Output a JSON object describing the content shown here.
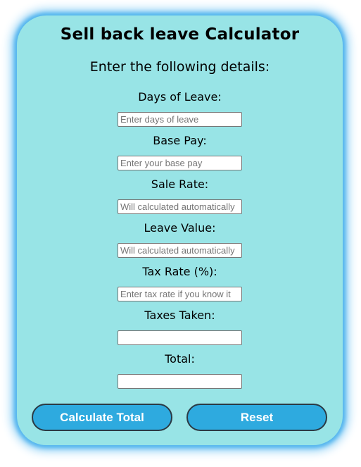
{
  "title": "Sell back leave Calculator",
  "subtitle": "Enter the following details:",
  "fields": [
    {
      "label": "Days of Leave:",
      "placeholder": "Enter days of leave",
      "value": ""
    },
    {
      "label": "Base Pay:",
      "placeholder": "Enter your base pay",
      "value": ""
    },
    {
      "label": "Sale Rate:",
      "placeholder": "Will calculated automatically",
      "value": ""
    },
    {
      "label": "Leave Value:",
      "placeholder": "Will calculated automatically",
      "value": ""
    },
    {
      "label": "Tax Rate (%):",
      "placeholder": "Enter tax rate if you know it",
      "value": ""
    },
    {
      "label": "Taxes Taken:",
      "placeholder": "",
      "value": ""
    },
    {
      "label": "Total:",
      "placeholder": "",
      "value": ""
    }
  ],
  "buttons": {
    "calculate": "Calculate Total",
    "reset": "Reset"
  },
  "colors": {
    "card_background": "#98e4e6",
    "glow": "#52b4ee",
    "button": "#2eaadf"
  }
}
